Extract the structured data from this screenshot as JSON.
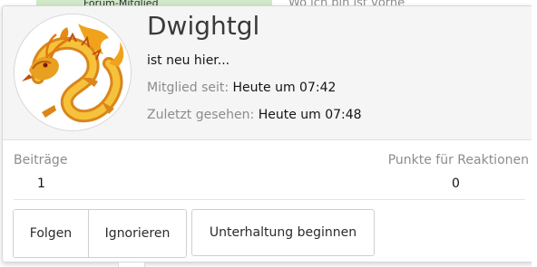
{
  "background": {
    "top_left_text": "Forum-Mitglied",
    "top_right_text": "Wo ich bin ist vorne"
  },
  "profile": {
    "avatar_icon": "dragon-avatar-icon",
    "username": "Dwightgl",
    "user_title": "ist neu hier...",
    "joined_label": "Mitglied seit:",
    "joined_value": "Heute um 07:42",
    "last_seen_label": "Zuletzt gesehen:",
    "last_seen_value": "Heute um 07:48"
  },
  "stats": {
    "posts_label": "Beiträge",
    "posts_value": "1",
    "reaction_points_label": "Punkte für Reaktionen",
    "reaction_points_value": "0"
  },
  "actions": {
    "follow_label": "Folgen",
    "ignore_label": "Ignorieren",
    "start_conversation_label": "Unterhaltung beginnen"
  },
  "colors": {
    "header_bg": "#f5f5f5",
    "muted_text": "#8c8c8c",
    "green_bar": "#cfe9c9"
  }
}
